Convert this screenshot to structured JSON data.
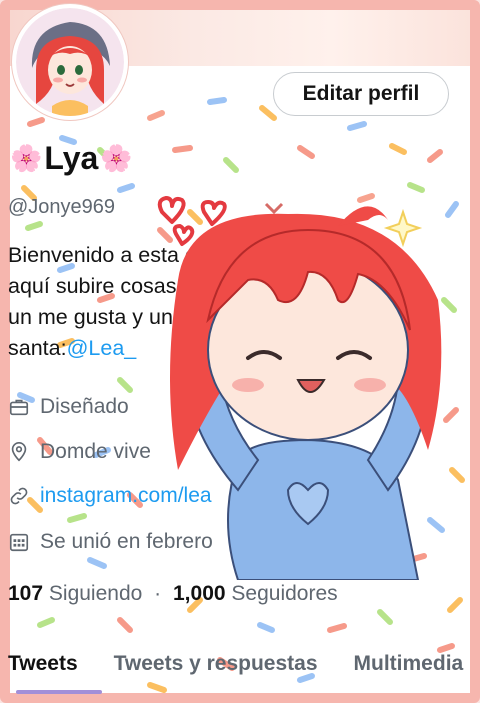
{
  "profile": {
    "flower_left": "🌸",
    "name": "Lya",
    "flower_right": "🌸",
    "handle": "@Jonye969",
    "edit_button": "Editar perfil",
    "bio_lines": [
      "Bienvenido a esta cuenta de Lea y por",
      "aquí subire cosas, si te gustan regalas",
      "un me gusta y una cuenta en",
      "santa:"
    ],
    "bio_mention": "@Lea_",
    "meta": {
      "designed": "Diseñado",
      "location": "Domde vive",
      "link": "instagram.com/lea",
      "joined": "Se unió en febrero"
    },
    "following_count": "107",
    "following_label": "Siguiendo",
    "separator": "·",
    "followers_count": "1,000",
    "followers_label": "Seguidores"
  },
  "tabs": [
    {
      "label": "Tweets",
      "active": true
    },
    {
      "label": "Tweets y respuestas",
      "active": false
    },
    {
      "label": "Multimedia",
      "active": false
    }
  ],
  "icons": {
    "designed": "briefcase-icon",
    "location": "map-pin-icon",
    "link": "link-icon",
    "joined": "calendar-icon"
  },
  "colors": {
    "frame": "#f6b6ae",
    "accent": "#1d9bf0",
    "hair": "#ef4b47",
    "shirt": "#8db6ea",
    "tab_indicator": "#a28fd8"
  }
}
